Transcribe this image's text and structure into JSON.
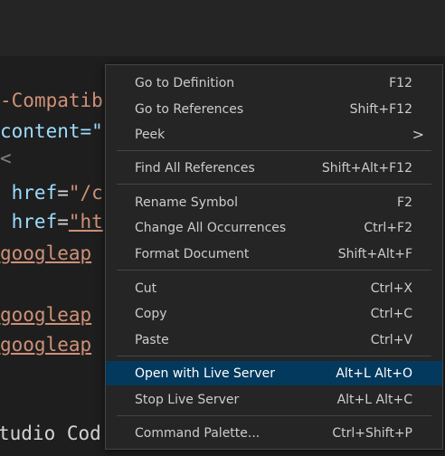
{
  "code_lines": [
    {
      "prefix": "-",
      "text": "Compatib"
    },
    {
      "text": "content=\""
    },
    {
      "text": "<"
    },
    {
      "attr": " href",
      "eq": "=",
      "str": "\"/c"
    },
    {
      "attr": " href",
      "eq": "=",
      "str": "\"ht"
    },
    {
      "str": "googleap"
    },
    {
      "str": "googleap"
    },
    {
      "str": "googleap"
    },
    {
      "plain": "tudio Cod"
    }
  ],
  "menu": {
    "items": [
      {
        "label": "Go to Definition",
        "key": "F12"
      },
      {
        "label": "Go to References",
        "key": "Shift+F12"
      },
      {
        "label": "Peek",
        "chevron": ">"
      },
      {
        "label": "Find All References",
        "key": "Shift+Alt+F12"
      },
      {
        "label": "Rename Symbol",
        "key": "F2"
      },
      {
        "label": "Change All Occurrences",
        "key": "Ctrl+F2"
      },
      {
        "label": "Format Document",
        "key": "Shift+Alt+F"
      },
      {
        "label": "Cut",
        "key": "Ctrl+X"
      },
      {
        "label": "Copy",
        "key": "Ctrl+C"
      },
      {
        "label": "Paste",
        "key": "Ctrl+V"
      },
      {
        "label": "Open with Live Server",
        "key": "Alt+L Alt+O"
      },
      {
        "label": "Stop Live Server",
        "key": "Alt+L Alt+C"
      },
      {
        "label": "Command Palette...",
        "key": "Ctrl+Shift+P"
      }
    ]
  },
  "colors": {
    "menu_bg": "#252526",
    "highlight": "#04395e",
    "string": "#ce9178",
    "attribute": "#9cdcfe"
  }
}
